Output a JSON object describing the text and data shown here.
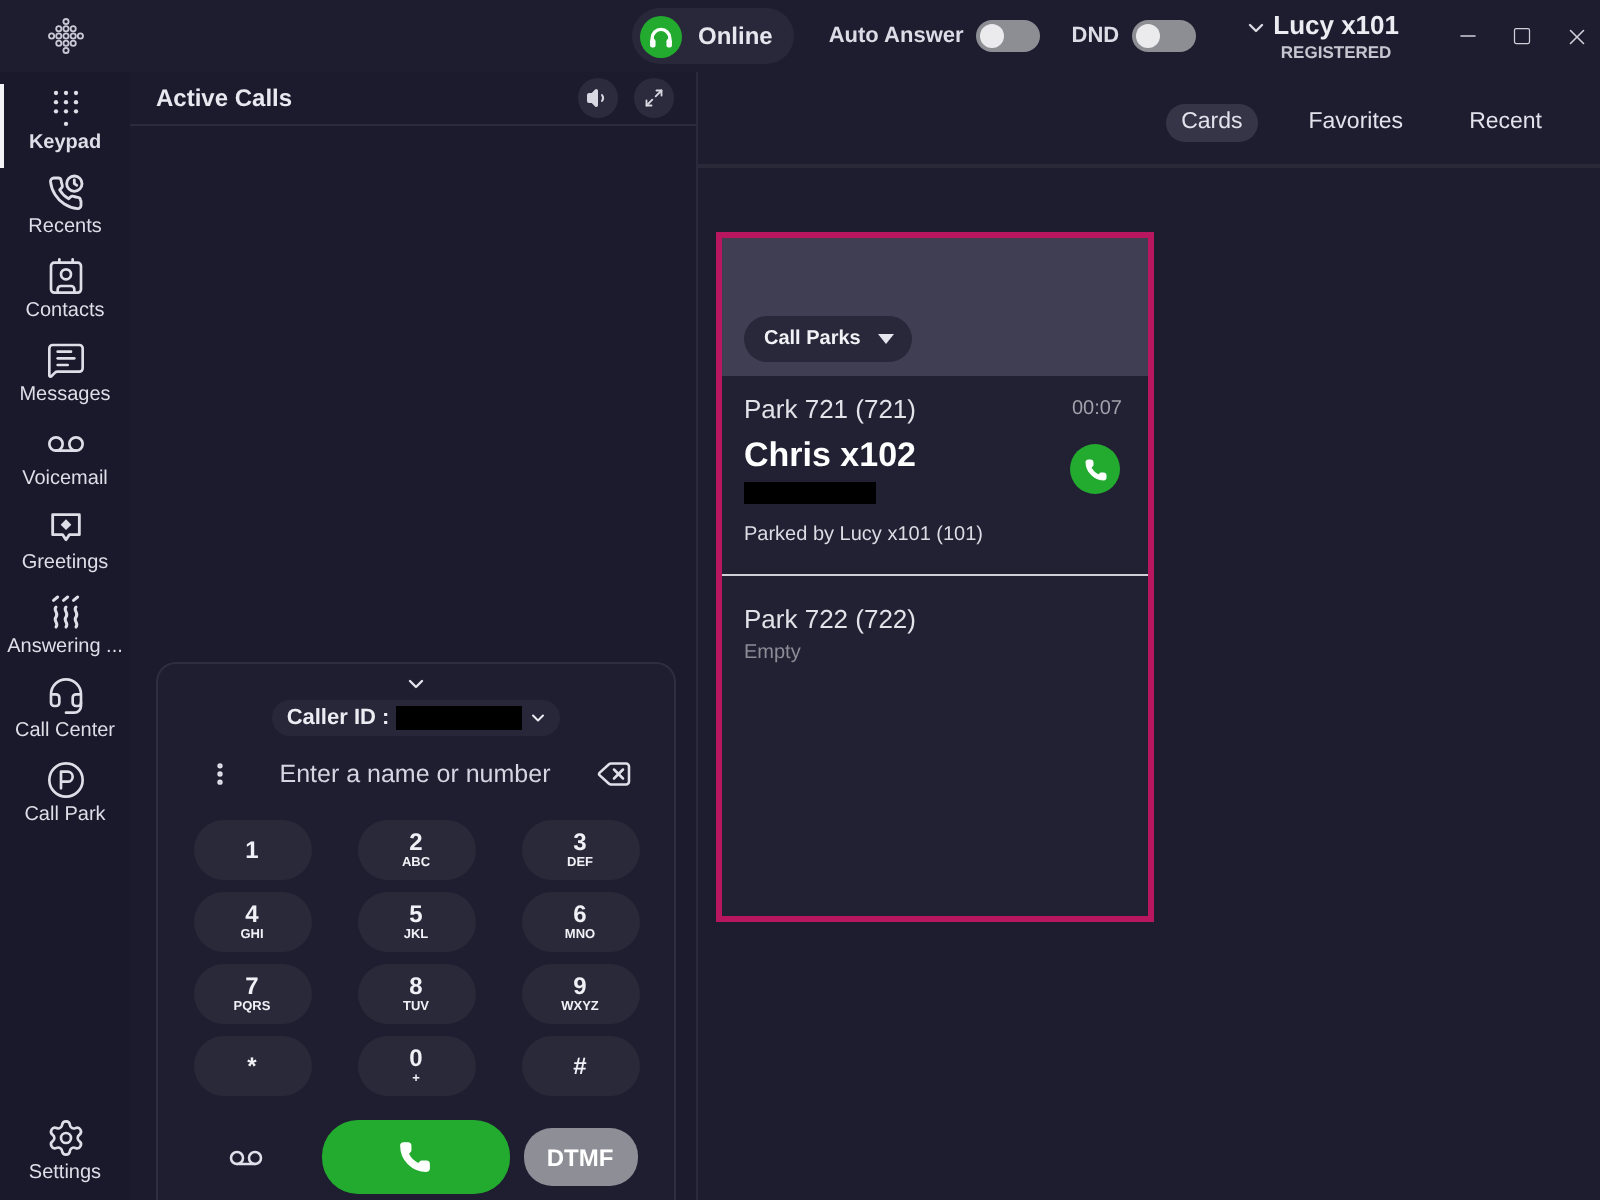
{
  "title_bar": {
    "status": {
      "label": "Online"
    },
    "toggles": [
      {
        "label": "Auto Answer",
        "on": false
      },
      {
        "label": "DND",
        "on": false
      }
    ],
    "account": {
      "name": "Lucy x101",
      "status": "REGISTERED"
    }
  },
  "sidebar": {
    "items": [
      {
        "kind": "keypad",
        "label": "Keypad",
        "selected": true
      },
      {
        "kind": "recents",
        "label": "Recents",
        "selected": false
      },
      {
        "kind": "contacts",
        "label": "Contacts",
        "selected": false
      },
      {
        "kind": "messages",
        "label": "Messages",
        "selected": false
      },
      {
        "kind": "voicemail",
        "label": "Voicemail",
        "selected": false
      },
      {
        "kind": "greetings",
        "label": "Greetings",
        "selected": false
      },
      {
        "kind": "answering",
        "label": "Answering ...",
        "selected": false
      },
      {
        "kind": "callcenter",
        "label": "Call Center",
        "selected": false
      },
      {
        "kind": "callpark",
        "label": "Call Park",
        "selected": false
      }
    ],
    "footer": {
      "kind": "settings",
      "label": "Settings",
      "selected": false
    }
  },
  "active_calls": {
    "title": "Active Calls"
  },
  "dialer": {
    "caller_id_label": "Caller ID :",
    "placeholder": "Enter a name or number",
    "keys": [
      {
        "digit": "1"
      },
      {
        "digit": "2",
        "letters": "ABC"
      },
      {
        "digit": "3",
        "letters": "DEF"
      },
      {
        "digit": "4",
        "letters": "GHI"
      },
      {
        "digit": "5",
        "letters": "JKL"
      },
      {
        "digit": "6",
        "letters": "MNO"
      },
      {
        "digit": "7",
        "letters": "PQRS"
      },
      {
        "digit": "8",
        "letters": "TUV"
      },
      {
        "digit": "9",
        "letters": "WXYZ"
      },
      {
        "digit": "*"
      },
      {
        "digit": "0",
        "letters": "+"
      },
      {
        "digit": "#"
      }
    ],
    "dtmf": {
      "label": "DTMF",
      "disabled": true
    }
  },
  "view_tabs": [
    {
      "label": "Cards",
      "selected": true
    },
    {
      "label": "Favorites",
      "selected": false
    },
    {
      "label": "Recent",
      "selected": false
    }
  ],
  "park_card": {
    "highlighted": true,
    "menu_label": "Call Parks",
    "parks": [
      {
        "title": "Park 721 (721)",
        "timer": "00:07",
        "caller": "Chris x102",
        "parked_by": "Parked by Lucy x101 (101)"
      },
      {
        "title": "Park 722 (722)",
        "status": "Empty"
      }
    ]
  }
}
